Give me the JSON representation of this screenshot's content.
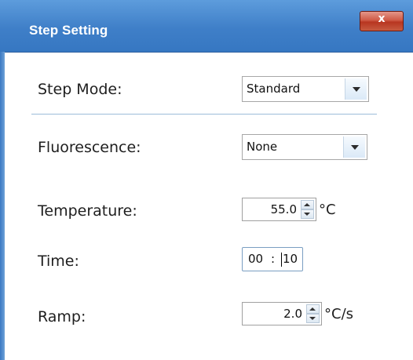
{
  "dialog": {
    "title": "Step Setting",
    "close_label": "x"
  },
  "fields": {
    "step_mode": {
      "label": "Step Mode:",
      "value": "Standard"
    },
    "fluorescence": {
      "label": "Fluorescence:",
      "value": "None"
    },
    "temperature": {
      "label": "Temperature:",
      "value": "55.0",
      "unit": "°C"
    },
    "time": {
      "label": "Time:",
      "minutes": "00",
      "separator": ":",
      "seconds": "10"
    },
    "ramp": {
      "label": "Ramp:",
      "value": "2.0",
      "unit": "°C/s"
    }
  },
  "icons": {
    "dropdown": "chevron-down-icon",
    "spin_up": "spin-up-icon",
    "spin_down": "spin-down-icon",
    "close": "close-icon"
  },
  "colors": {
    "titlebar": "#3f7fc8",
    "close_button": "#c4472f",
    "divider": "#9cbcd9"
  }
}
